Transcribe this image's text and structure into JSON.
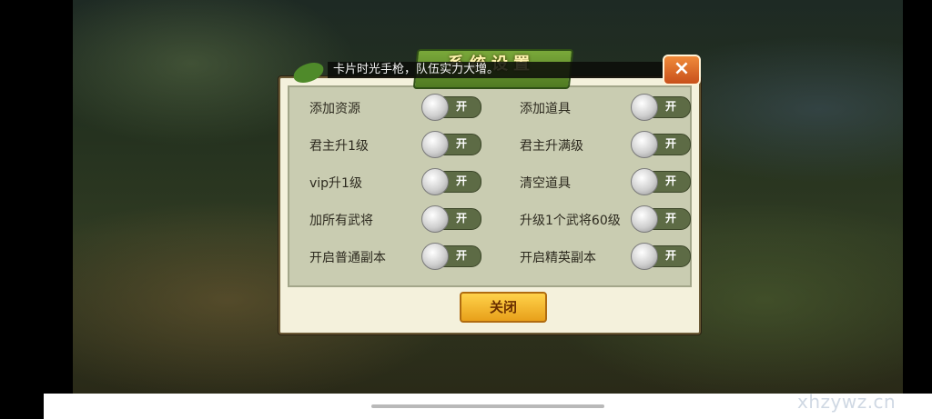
{
  "dialog": {
    "title": "系统设置",
    "marquee": "卡片时光手枪，队伍实力大增。",
    "close_icon": "×",
    "close_button_label": "关闭",
    "toggle_on_text": "开",
    "options": [
      {
        "label": "添加资源"
      },
      {
        "label": "添加道具"
      },
      {
        "label": "君主升1级"
      },
      {
        "label": "君主升满级"
      },
      {
        "label": "vip升1级"
      },
      {
        "label": "清空道具"
      },
      {
        "label": "加所有武将"
      },
      {
        "label": "升级1个武将60级"
      },
      {
        "label": "开启普通副本"
      },
      {
        "label": "开启精英副本"
      }
    ]
  },
  "watermark": "xhzywz.cn",
  "colors": {
    "accent": "#e8a01a",
    "toggle_track": "#5d6b45",
    "panel": "#c9ccb1"
  }
}
